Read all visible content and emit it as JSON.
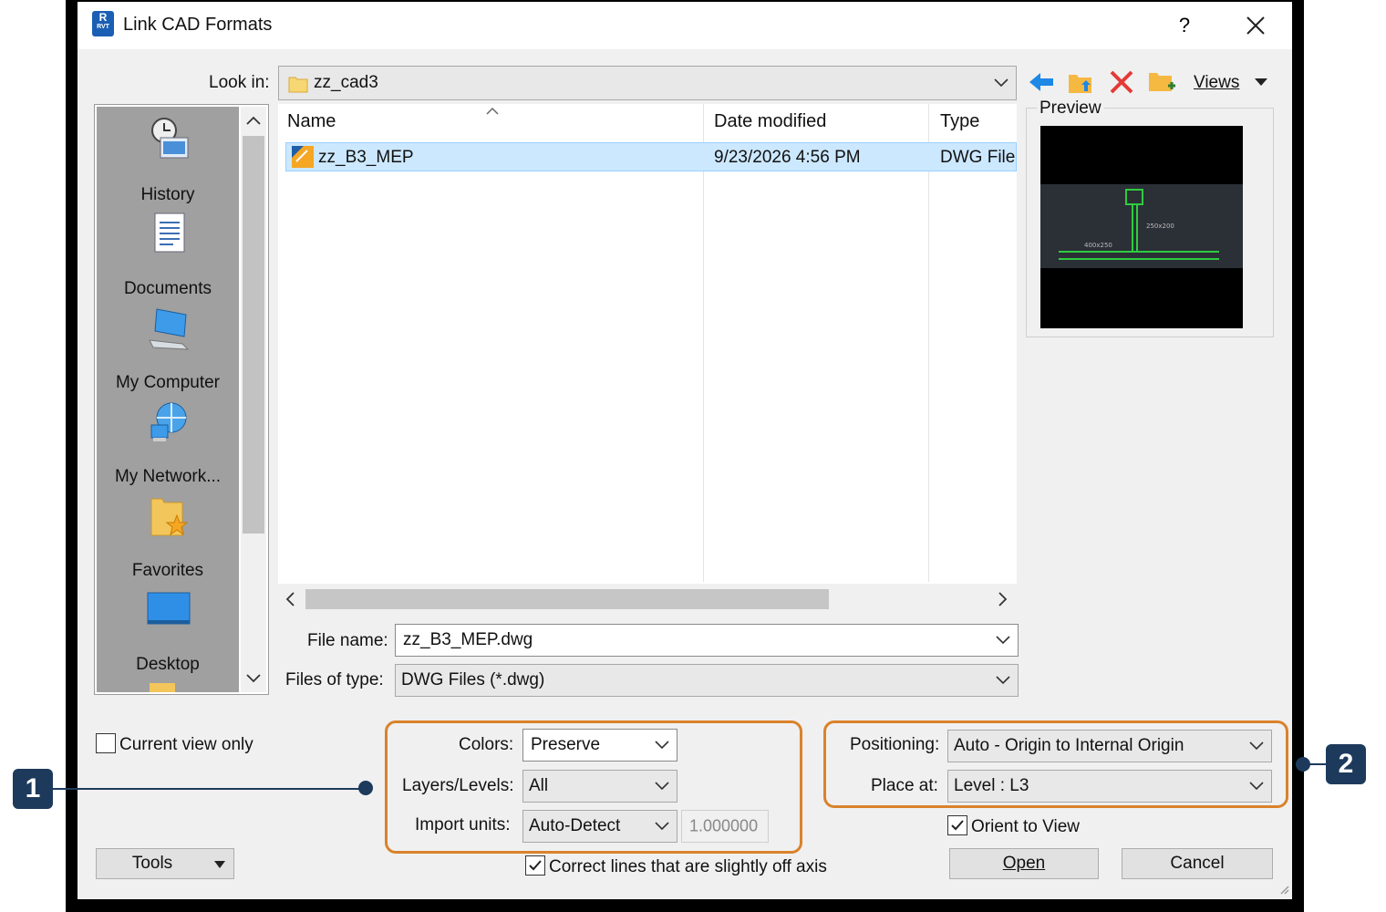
{
  "window": {
    "title": "Link CAD Formats",
    "help": "?"
  },
  "look_in": {
    "label": "Look in:",
    "value": "zz_cad3"
  },
  "toolbar": {
    "views_label": "Views"
  },
  "places": [
    {
      "label": "History",
      "icon": "history-icon"
    },
    {
      "label": "Documents",
      "icon": "documents-icon"
    },
    {
      "label": "My Computer",
      "icon": "computer-icon"
    },
    {
      "label": "My Network...",
      "icon": "network-icon"
    },
    {
      "label": "Favorites",
      "icon": "favorites-icon"
    },
    {
      "label": "Desktop",
      "icon": "desktop-icon"
    }
  ],
  "file_list": {
    "columns": [
      "Name",
      "Date modified",
      "Type"
    ],
    "rows": [
      {
        "name": "zz_B3_MEP",
        "date": "9/23/2026 4:56 PM",
        "type": "DWG File"
      }
    ]
  },
  "preview": {
    "label": "Preview",
    "dim1": "250x200",
    "dim2": "400x250"
  },
  "file_name": {
    "label": "File name:",
    "value": "zz_B3_MEP.dwg"
  },
  "file_type": {
    "label": "Files of type:",
    "value": "DWG Files (*.dwg)"
  },
  "current_view_only": {
    "label": "Current view only",
    "checked": false
  },
  "colors": {
    "label": "Colors:",
    "value": "Preserve"
  },
  "layers": {
    "label": "Layers/Levels:",
    "value": "All"
  },
  "import_units": {
    "label": "Import units:",
    "value": "Auto-Detect",
    "factor": "1.000000"
  },
  "correct_lines": {
    "label": "Correct lines that are slightly off axis",
    "checked": true
  },
  "positioning": {
    "label": "Positioning:",
    "value": "Auto - Origin to Internal Origin"
  },
  "place_at": {
    "label": "Place at:",
    "value": "Level : L3"
  },
  "orient_to_view": {
    "label": "Orient to View",
    "checked": true
  },
  "buttons": {
    "tools": "Tools",
    "open": "Open",
    "cancel": "Cancel"
  },
  "callouts": {
    "one": "1",
    "two": "2"
  },
  "colors_theme": {
    "highlight": "#d9822b",
    "callout": "#1d3a5c",
    "selection": "#cce8ff"
  }
}
